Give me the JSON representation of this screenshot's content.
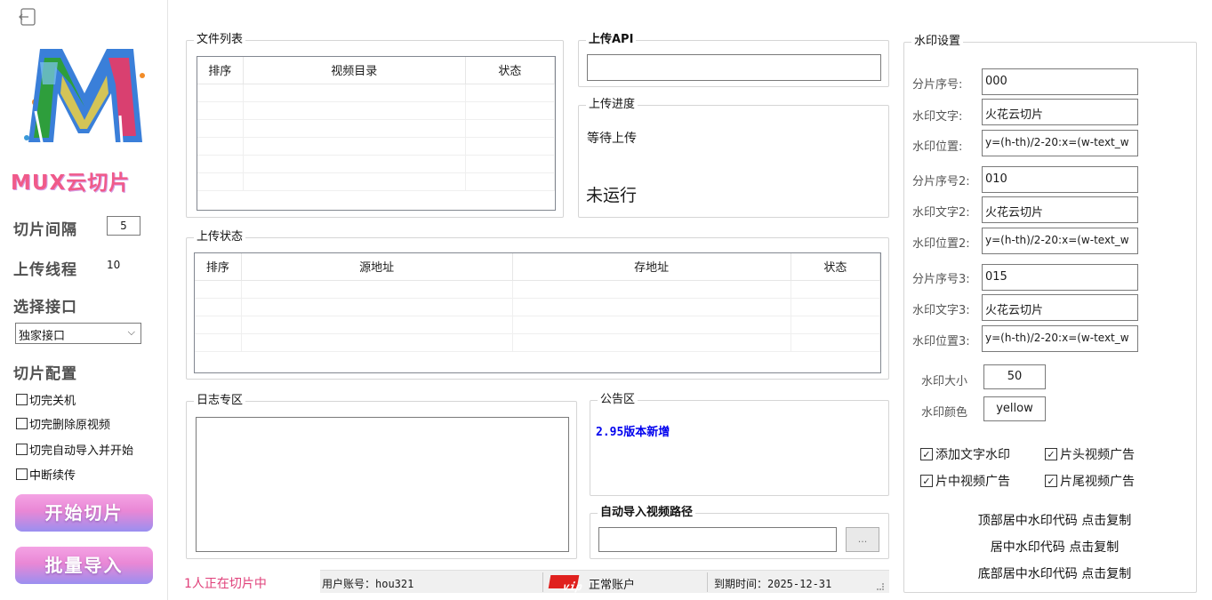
{
  "sidebar": {
    "logo_text": "MUX云切片",
    "slice_interval_label": "切片间隔",
    "slice_interval_value": "5",
    "upload_threads_label": "上传线程",
    "upload_threads_value": "10",
    "select_api_label": "选择接口",
    "select_api_value": "独家接口",
    "slice_config_label": "切片配置",
    "options": [
      {
        "label": "切完关机",
        "checked": false
      },
      {
        "label": "切完删除原视频",
        "checked": false
      },
      {
        "label": "切完自动导入并开始",
        "checked": false
      },
      {
        "label": "中断续传",
        "checked": false
      }
    ],
    "start_button": "开始切片",
    "batch_import_button": "批量导入"
  },
  "file_list": {
    "title": "文件列表",
    "columns": [
      "排序",
      "视频目录",
      "状态"
    ]
  },
  "upload_api": {
    "title": "上传API",
    "value": ""
  },
  "upload_progress": {
    "title": "上传进度",
    "status_text": "等待上传",
    "run_state": "未运行"
  },
  "upload_status": {
    "title": "上传状态",
    "columns": [
      "排序",
      "源地址",
      "存地址",
      "状态"
    ]
  },
  "log_area": {
    "title": "日志专区"
  },
  "notice": {
    "title": "公告区",
    "text": "2.95版本新增"
  },
  "auto_import": {
    "title": "自动导入视频路径",
    "value": "",
    "browse_label": "..."
  },
  "status_bar": {
    "slicing_count": "1人正在切片中",
    "account": "用户账号：hou321",
    "vip_badge": "vip",
    "account_type": "正常账户",
    "expiry": "到期时间：2025-12-31"
  },
  "watermark": {
    "title": "水印设置",
    "rows": [
      {
        "label": "分片序号:",
        "value": "000"
      },
      {
        "label": "水印文字:",
        "value": "火花云切片"
      },
      {
        "label": "水印位置:",
        "value": "y=(h-th)/2-20:x=(w-text_w"
      },
      {
        "label": "分片序号2:",
        "value": "010"
      },
      {
        "label": "水印文字2:",
        "value": "火花云切片"
      },
      {
        "label": "水印位置2:",
        "value": "y=(h-th)/2-20:x=(w-text_w"
      },
      {
        "label": "分片序号3:",
        "value": "015"
      },
      {
        "label": "水印文字3:",
        "value": "火花云切片"
      },
      {
        "label": "水印位置3:",
        "value": "y=(h-th)/2-20:x=(w-text_w"
      }
    ],
    "size_label": "水印大小",
    "size_value": "50",
    "color_label": "水印颜色",
    "color_value": "yellow",
    "checks": [
      {
        "label": "添加文字水印",
        "checked": true
      },
      {
        "label": "片头视频广告",
        "checked": true
      },
      {
        "label": "片中视频广告",
        "checked": true
      },
      {
        "label": "片尾视频广告",
        "checked": true
      }
    ],
    "copy_links": [
      "顶部居中水印代码 点击复制",
      "居中水印代码 点击复制",
      "底部居中水印代码 点击复制"
    ]
  },
  "colors": {
    "accent_pink": "#e987d5",
    "notice_blue": "#0000ee",
    "slicing_pink": "#e0407a"
  }
}
